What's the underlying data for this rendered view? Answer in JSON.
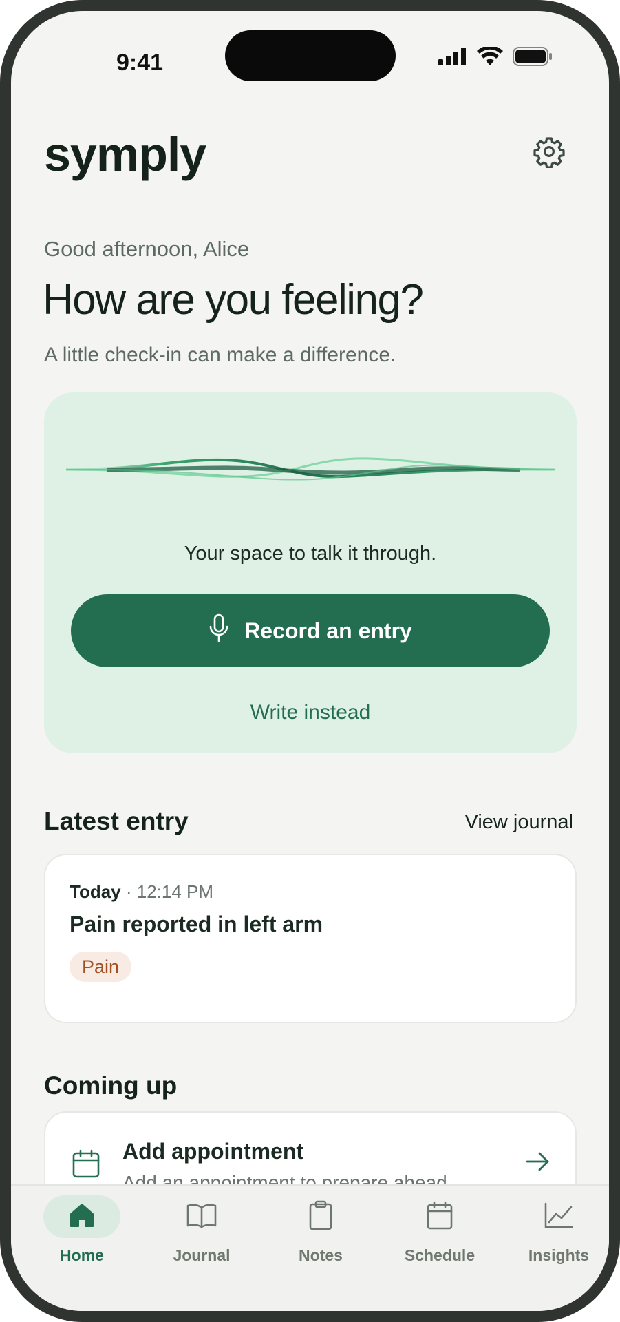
{
  "status_bar": {
    "time": "9:41"
  },
  "header": {
    "brand": "symply"
  },
  "greeting": "Good afternoon, Alice",
  "headline": "How are you feeling?",
  "subhead": "A little check-in can make a difference.",
  "voice_card": {
    "prompt": "Your space to talk it through.",
    "record_label": "Record an entry",
    "write_label": "Write instead"
  },
  "latest": {
    "title": "Latest entry",
    "view_link": "View journal",
    "entry": {
      "day": "Today",
      "separator": " · ",
      "time": "12:14 PM",
      "title": "Pain reported in left arm",
      "tag": "Pain"
    }
  },
  "coming_up": {
    "title": "Coming up",
    "card_title": "Add appointment",
    "card_subtitle": "Add an appointment to prepare ahead"
  },
  "tabs": [
    {
      "label": "Home",
      "icon": "home-icon",
      "active": true
    },
    {
      "label": "Journal",
      "icon": "book-icon",
      "active": false
    },
    {
      "label": "Notes",
      "icon": "clipboard-icon",
      "active": false
    },
    {
      "label": "Schedule",
      "icon": "calendar-icon",
      "active": false
    },
    {
      "label": "Insights",
      "icon": "chart-icon",
      "active": false
    }
  ],
  "colors": {
    "accent": "#236e51",
    "card_bg": "#dff0e5",
    "screen_bg": "#f4f4f2",
    "tag_bg": "#f8ebe3",
    "tag_text": "#a34f22"
  }
}
